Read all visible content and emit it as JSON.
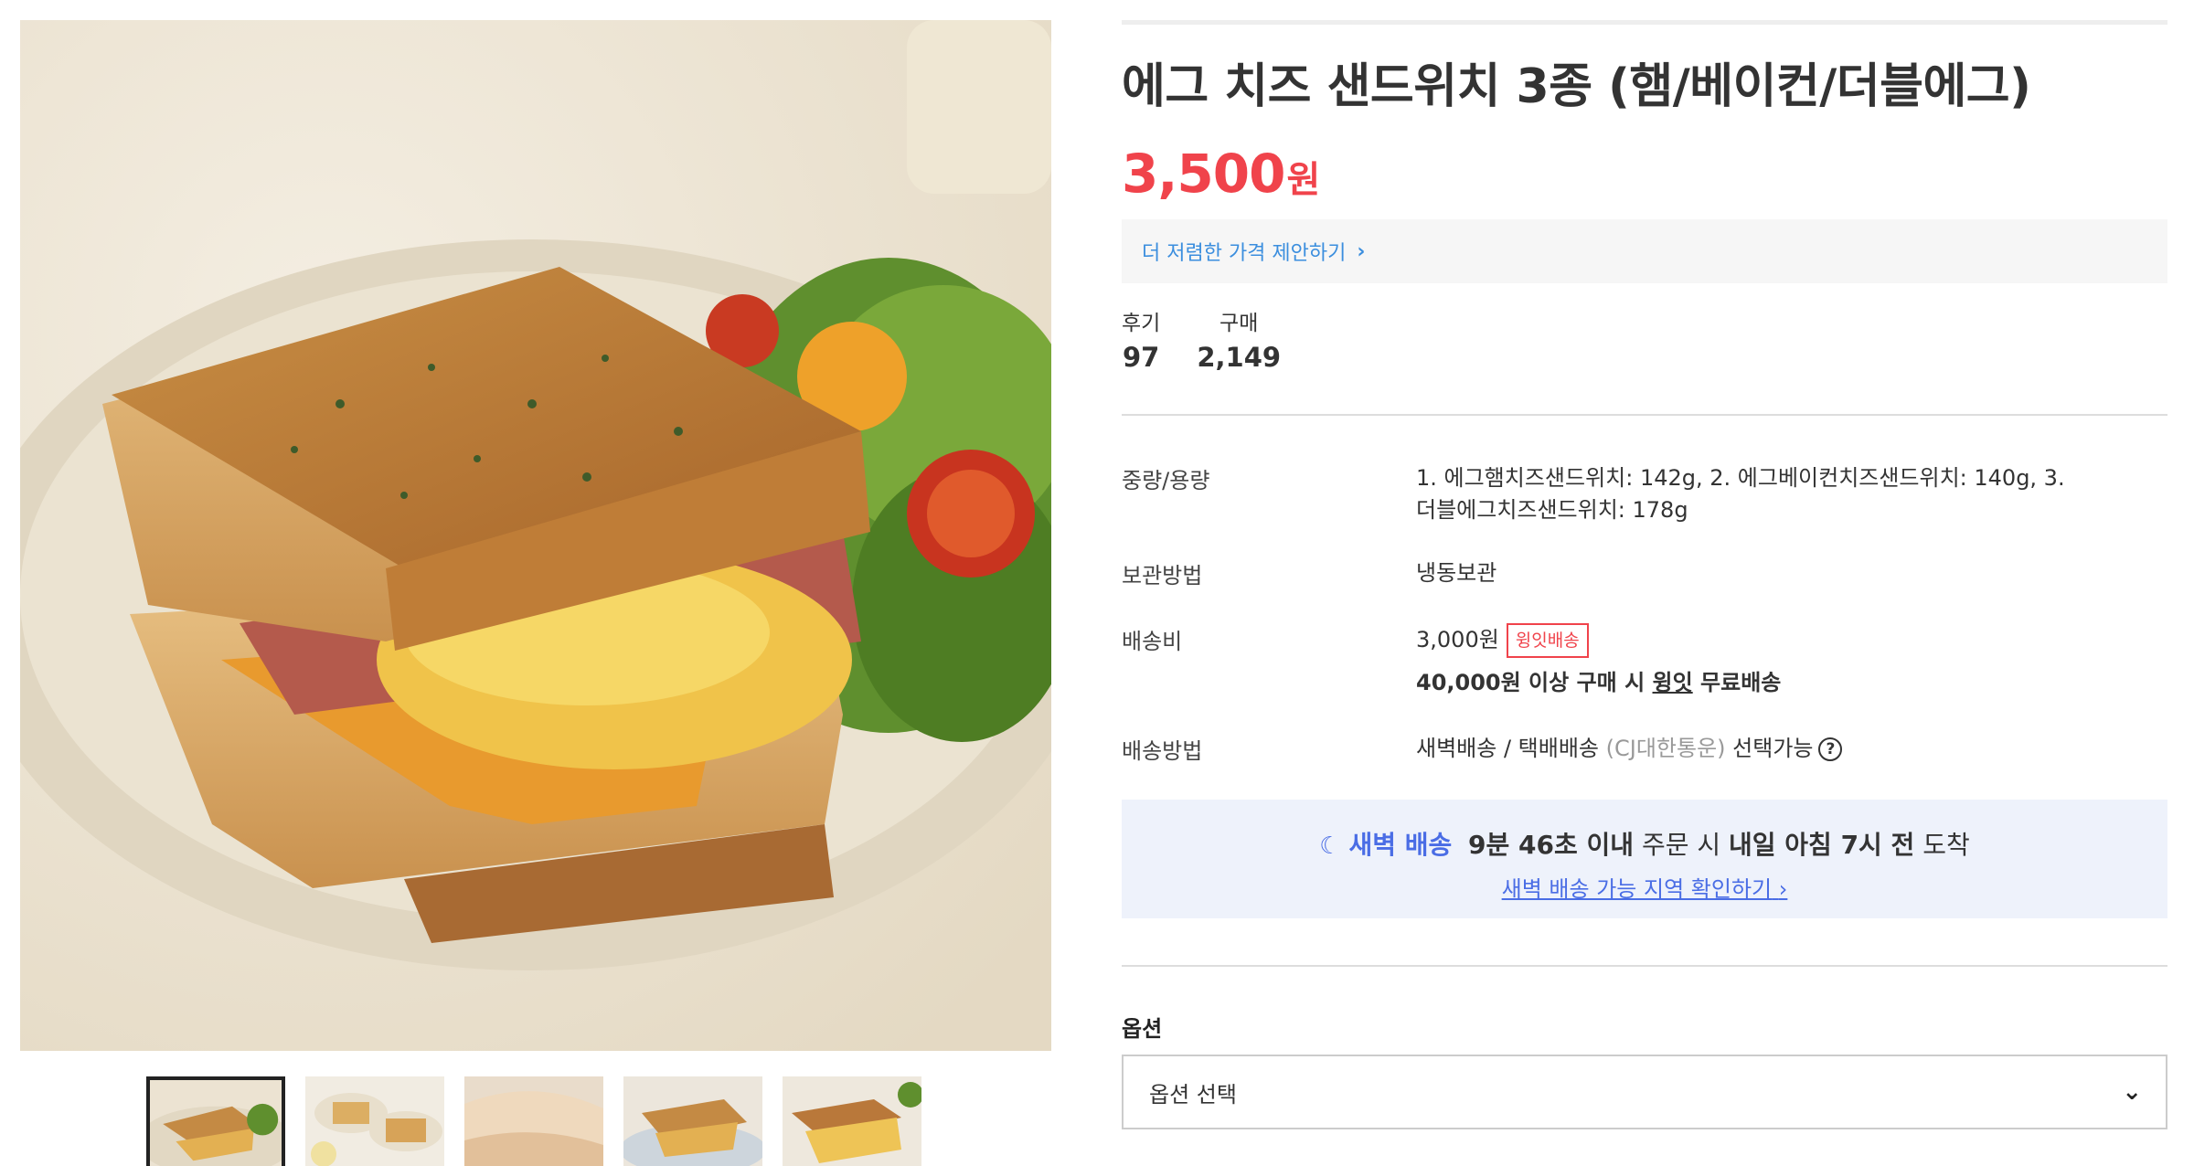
{
  "product": {
    "title": "에그 치즈 샌드위치 3종 (햄/베이컨/더블에그)",
    "price": "3,500",
    "price_unit": "원",
    "offer_link": "더 저렴한 가격 제안하기",
    "stats": [
      {
        "label": "후기",
        "value": "97"
      },
      {
        "label": "구매",
        "value": "2,149"
      }
    ]
  },
  "specs": {
    "weight_label": "중량/용량",
    "weight_line1": "1. 에그햄치즈샌드위치: 142g, 2. 에그베이컨치즈샌드위치: 140g, 3.",
    "weight_line2": "더블에그치즈샌드위치: 178g",
    "storage_label": "보관방법",
    "storage_value": "냉동보관",
    "shipping_fee_label": "배송비",
    "shipping_fee_value": "3,000원",
    "shipping_badge": "윙잇배송",
    "free_ship_pre": "40,000원 이상 구매 시 ",
    "free_ship_brand": "윙잇",
    "free_ship_post": " 무료배송",
    "shipping_method_label": "배송방법",
    "shipping_method_value": "새벽배송 / 택배배송",
    "shipping_carrier": "(CJ대한통운)",
    "shipping_choice": "선택가능",
    "help_glyph": "?"
  },
  "dawn": {
    "icon": "moon-icon",
    "label": "새벽 배송",
    "countdown": "9분 46초 이내",
    "order_text": "주문 시",
    "arrival_day": "내일 아침 7시 전",
    "arrival_text": "도착",
    "link": "새벽 배송 가능 지역 확인하기"
  },
  "option": {
    "label": "옵션",
    "placeholder": "옵션 선택"
  },
  "colors": {
    "price_red": "#f0434b",
    "link_blue": "#3b8ede",
    "dawn_blue": "#4a6de5",
    "dawn_bg": "#eef2fb"
  }
}
